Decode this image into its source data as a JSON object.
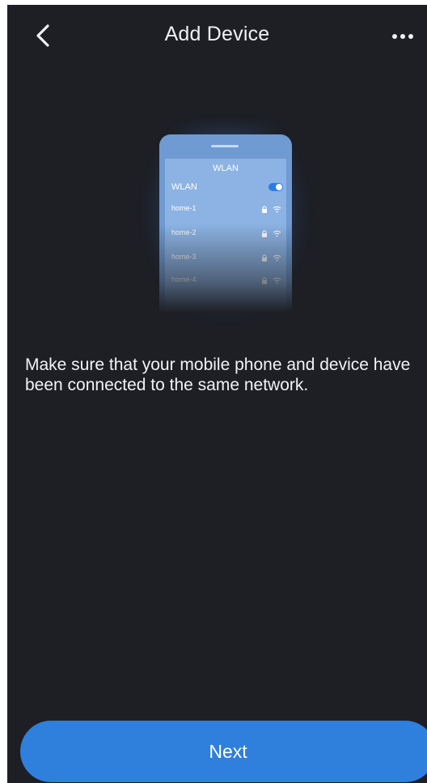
{
  "header": {
    "title": "Add Device",
    "back_icon": "chevron-left-icon",
    "more_icon": "more-horizontal-icon"
  },
  "illustration": {
    "screen_title": "WLAN",
    "wlan_label": "WLAN",
    "wlan_enabled": true,
    "networks": [
      {
        "name": "home-1"
      },
      {
        "name": "home-2"
      },
      {
        "name": "home-3"
      },
      {
        "name": "home-4"
      }
    ]
  },
  "message": "Make sure that your mobile phone and device have been connected to the same network.",
  "next_button": {
    "label": "Next"
  },
  "colors": {
    "background": "#1d1f25",
    "accent": "#2f7fdd",
    "text": "#f2f3f5"
  }
}
